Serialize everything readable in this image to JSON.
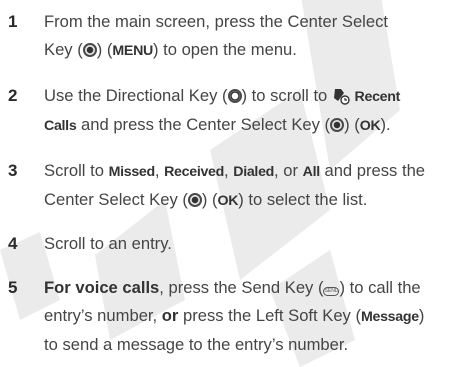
{
  "steps": [
    {
      "number": "1",
      "line1": "From the main screen, press the Center Select",
      "line2a": "Key (",
      "line2b": ") (",
      "menu_label": "MENU",
      "line2c": ") to open the menu.",
      "icons": [
        "center-select-key-icon"
      ]
    },
    {
      "number": "2",
      "line1a": "Use the Directional Key (",
      "line1b": ") to scroll to ",
      "recent_label": "Recent",
      "calls_label": "Calls",
      "line2b": " and press the Center Select Key (",
      "line2c": ") (",
      "ok_label": "OK",
      "line2d": ").",
      "icons": [
        "directional-key-icon",
        "recent-calls-icon",
        "center-select-key-icon"
      ]
    },
    {
      "number": "3",
      "line1a": "Scroll to ",
      "missed": "Missed",
      "sep1": ", ",
      "received": "Received",
      "sep2": ", ",
      "dialed": "Dialed",
      "sep3": ", or ",
      "all": "All",
      "line1b": " and press the",
      "line2a": "Center Select Key (",
      "line2b": ") (",
      "ok_label": "OK",
      "line2c": ") to select the list.",
      "icons": [
        "center-select-key-icon"
      ]
    },
    {
      "number": "4",
      "line1": "Scroll to an entry."
    },
    {
      "number": "5",
      "bold_lead": "For voice calls",
      "line1a": ", press the Send Key (",
      "line1b": ") to call the",
      "line2a": "entry’s number, ",
      "or_label": "or",
      "line2b": " press the Left Soft Key (",
      "message_label": "Message",
      "line2c": ")",
      "line3": "to send a message to the entry’s number.",
      "icons": [
        "send-key-icon"
      ]
    }
  ],
  "watermark_text": "DRAFT"
}
